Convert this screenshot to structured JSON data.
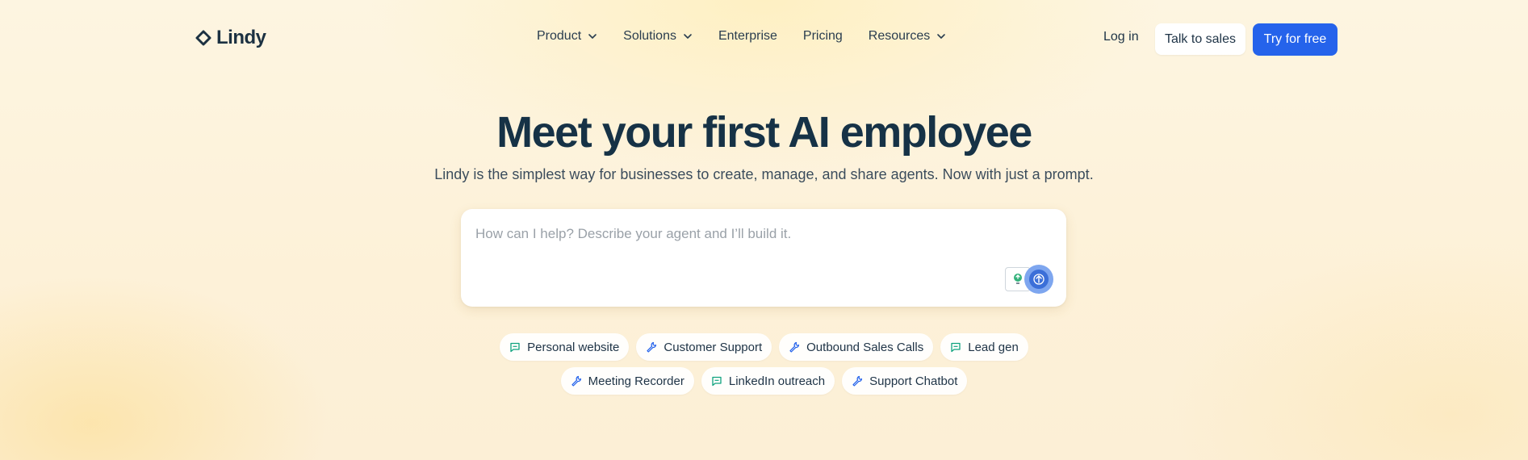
{
  "brand": {
    "name": "Lindy"
  },
  "nav": {
    "links": [
      {
        "label": "Product",
        "has_dropdown": true
      },
      {
        "label": "Solutions",
        "has_dropdown": true
      },
      {
        "label": "Enterprise",
        "has_dropdown": false
      },
      {
        "label": "Pricing",
        "has_dropdown": false
      },
      {
        "label": "Resources",
        "has_dropdown": true
      }
    ],
    "login_label": "Log in",
    "sales_label": "Talk to sales",
    "try_label": "Try for free"
  },
  "hero": {
    "title": "Meet your first AI employee",
    "subtitle": "Lindy is the simplest way for businesses to create, manage, and share agents. Now with just a prompt."
  },
  "prompt": {
    "placeholder": "How can I help? Describe your agent and I’ll build it.",
    "value": ""
  },
  "suggestions": {
    "row1": [
      {
        "label": "Personal website",
        "icon": "chat-bubble-icon"
      },
      {
        "label": "Customer Support",
        "icon": "wrench-icon"
      },
      {
        "label": "Outbound Sales Calls",
        "icon": "wrench-icon"
      },
      {
        "label": "Lead gen",
        "icon": "chat-bubble-icon"
      }
    ],
    "row2": [
      {
        "label": "Meeting Recorder",
        "icon": "wrench-icon"
      },
      {
        "label": "LinkedIn outreach",
        "icon": "chat-bubble-icon"
      },
      {
        "label": "Support Chatbot",
        "icon": "wrench-icon"
      }
    ]
  },
  "colors": {
    "primary": "#2563eb",
    "heading": "#163246",
    "chat_icon": "#10a37f",
    "wrench_icon": "#2563eb"
  }
}
